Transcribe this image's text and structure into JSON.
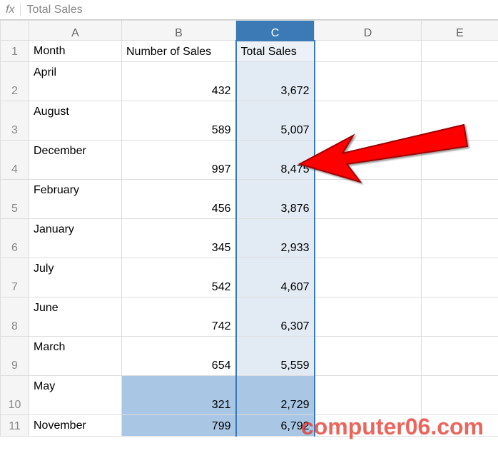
{
  "formula_bar": {
    "fx_label": "fx",
    "value": "Total Sales"
  },
  "columns": [
    "A",
    "B",
    "C",
    "D",
    "E"
  ],
  "headers": {
    "month": "Month",
    "num_sales": "Number of Sales",
    "total_sales": "Total Sales"
  },
  "row_numbers": [
    "1",
    "2",
    "3",
    "4",
    "5",
    "6",
    "7",
    "8",
    "9",
    "10",
    "11"
  ],
  "rows": [
    {
      "month": "April",
      "num_sales": "432",
      "total_sales": "3,672"
    },
    {
      "month": "August",
      "num_sales": "589",
      "total_sales": "5,007"
    },
    {
      "month": "December",
      "num_sales": "997",
      "total_sales": "8,475"
    },
    {
      "month": "February",
      "num_sales": "456",
      "total_sales": "3,876"
    },
    {
      "month": "January",
      "num_sales": "345",
      "total_sales": "2,933"
    },
    {
      "month": "July",
      "num_sales": "542",
      "total_sales": "4,607"
    },
    {
      "month": "June",
      "num_sales": "742",
      "total_sales": "6,307"
    },
    {
      "month": "March",
      "num_sales": "654",
      "total_sales": "5,559"
    },
    {
      "month": "May",
      "num_sales": "321",
      "total_sales": "2,729"
    },
    {
      "month": "November",
      "num_sales": "799",
      "total_sales": "6,792"
    }
  ],
  "watermark": "computer06.com",
  "chart_data": {
    "type": "table",
    "columns": [
      "Month",
      "Number of Sales",
      "Total Sales"
    ],
    "rows": [
      [
        "April",
        432,
        3672
      ],
      [
        "August",
        589,
        5007
      ],
      [
        "December",
        997,
        8475
      ],
      [
        "February",
        456,
        3876
      ],
      [
        "January",
        345,
        2933
      ],
      [
        "July",
        542,
        4607
      ],
      [
        "June",
        742,
        6307
      ],
      [
        "March",
        654,
        5559
      ],
      [
        "May",
        321,
        2729
      ],
      [
        "November",
        799,
        6792
      ]
    ]
  }
}
